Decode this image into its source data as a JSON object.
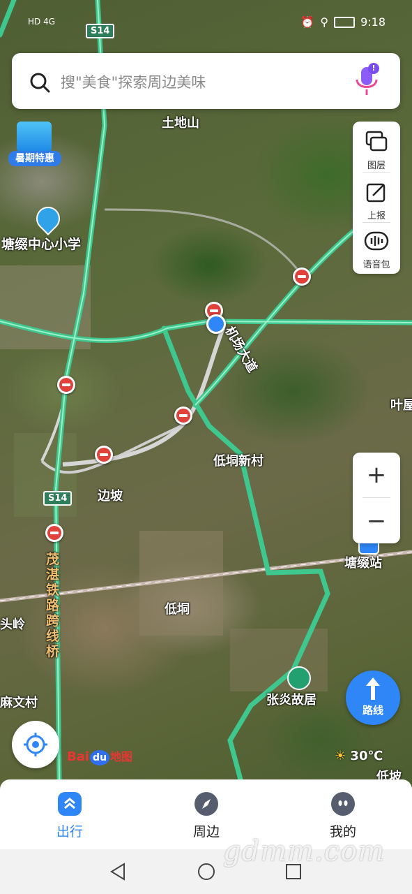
{
  "status_bar": {
    "left": "HD 4G",
    "time": "9:18"
  },
  "search": {
    "placeholder": "搜\"美食\"探索周边美味",
    "badge": "!"
  },
  "promo": {
    "label": "暑期特惠"
  },
  "side_tools": [
    {
      "label": "图层",
      "icon": "layers-icon"
    },
    {
      "label": "上报",
      "icon": "report-icon"
    },
    {
      "label": "语音包",
      "icon": "voice-pack-icon"
    }
  ],
  "zoom": {
    "in": "+",
    "out": "−"
  },
  "route": {
    "label": "路线"
  },
  "map_labels": {
    "s14_top": "S14",
    "s14_mid": "S14",
    "tudishan": "土地山",
    "school": "塘缀中心小学",
    "highway": "机场大道",
    "dishenxincun": "低垌新村",
    "bianba": "边坡",
    "maozhan": "茂湛铁路跨线桥",
    "didong": "低垌",
    "tangzhui_station": "塘缀站",
    "zhangyan": "张炎故居",
    "toulin": "头岭",
    "mawencun": "麻文村",
    "yeshu": "叶屋",
    "dipo": "低坡"
  },
  "brand": {
    "prefix": "Bai",
    "du": "du",
    "suffix": "地图"
  },
  "weather": {
    "temp": "30℃"
  },
  "bottom_nav": [
    {
      "label": "出行",
      "active": true
    },
    {
      "label": "周边",
      "active": false
    },
    {
      "label": "我的",
      "active": false
    }
  ],
  "watermark": "gdmm.com",
  "colors": {
    "road": "#3ec78e",
    "accent": "#2f86f6",
    "active_nav": "#2f86f6"
  }
}
